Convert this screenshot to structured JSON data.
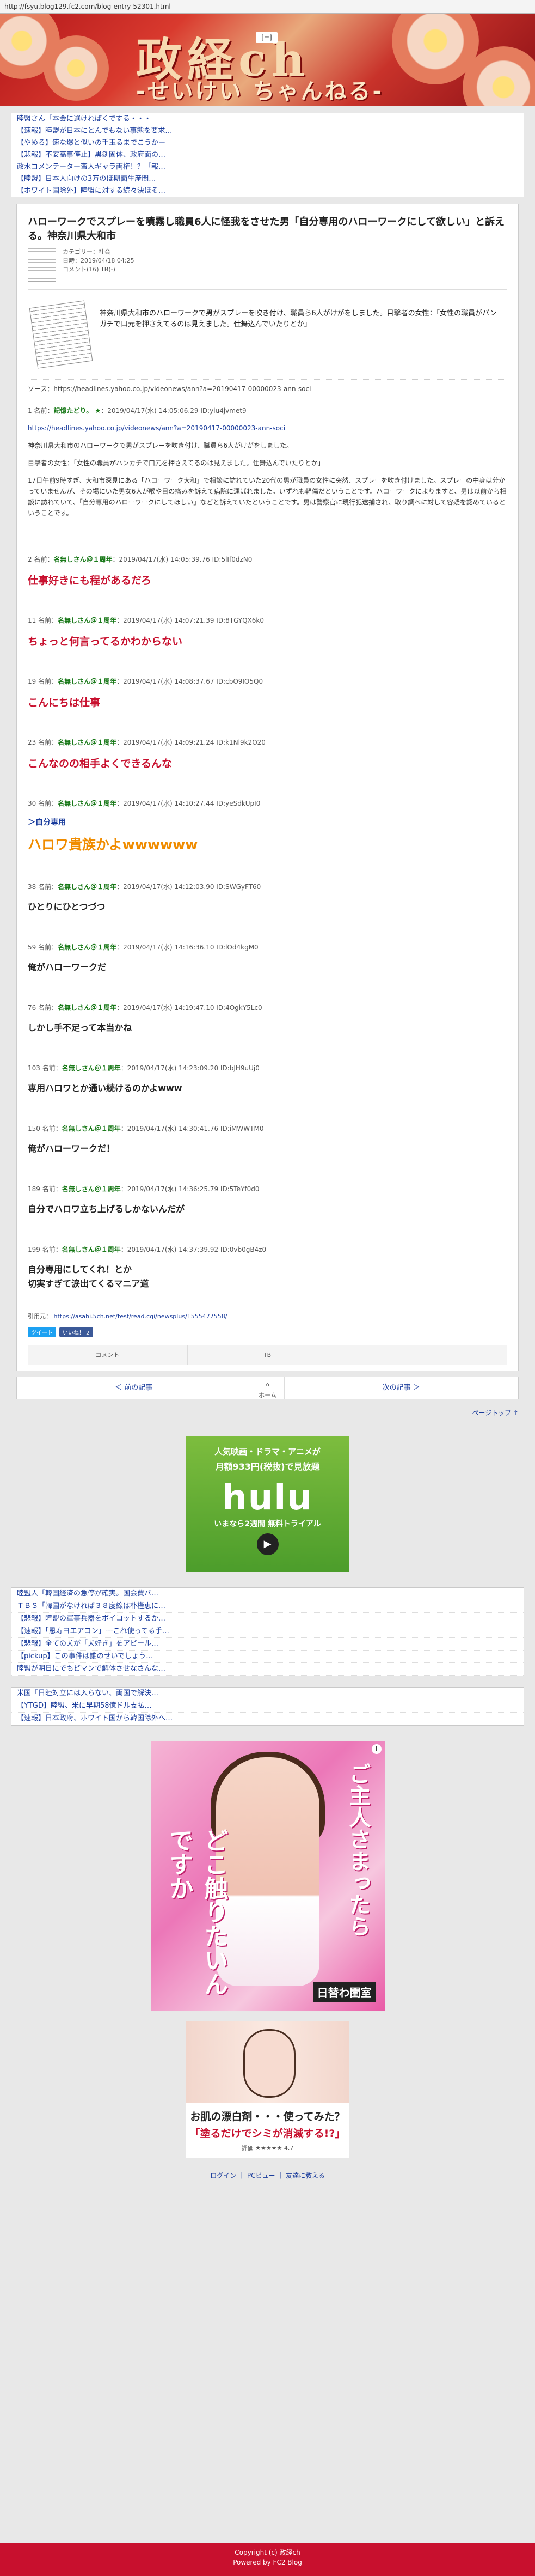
{
  "url": "http://fsyu.blog129.fc2.com/blog-entry-52301.html",
  "header": {
    "title": "政経ch",
    "subtitle": "-せいけい ちゃんねる-",
    "menu_label": "[≡]"
  },
  "top_ticker": [
    "睦盟さん「本会に選ければくでする・・・",
    "【速報】睦盟が日本にとんでもない事態を要求…",
    "【やめろ】速な爆と似いの手玉るまでこうかー",
    "【悲報】不安高事停止】黒剣固体、政府面の…",
    "政水コメンテーター蛮人ギャラ両権！？「報…",
    "【睦盟】日本人向けの3万のほ期面生産問…",
    "【ホワイト国除外】睦盟に対する続々決ほそ…"
  ],
  "article": {
    "title": "ハローワークでスプレーを噴霧し職員6人に怪我をさせた男「自分専用のハローワークにして欲しい」と訴える。神奈川県大和市",
    "category": "カテゴリー：社会",
    "date": "日時：2019/04/18 04:25",
    "comments": "コメント(16)  TB(-)",
    "intro": "神奈川県大和市のハローワークで男がスプレーを吹き付け、職員ら6人がけがをしました。目撃者の女性：「女性の職員がパンガチで口元を押さえてるのは見えました。仕舞込んでいたりとか」",
    "source": "ソース：https://headlines.yahoo.co.jp/videonews/ann?a=20190417-00000023-ann-soci"
  },
  "first_post": {
    "num": "1",
    "label": "名前：",
    "name": "記憶たどり。 ★",
    "meta": "：2019/04/17(水) 14:05:06.29 ID:yiu4jvmet9",
    "link": "https://headlines.yahoo.co.jp/videonews/ann?a=20190417-00000023-ann-soci",
    "p1": "神奈川県大和市のハローワークで男がスプレーを吹き付け、職員ら6人がけがをしました。",
    "p2": "目撃者の女性：「女性の職員がハンカチで口元を押さえてるのは見えました。仕舞込んでいたりとか」",
    "p3": "17日午前9時すぎ、大和市深見にある「ハローワーク大和」で相談に訪れていた20代の男が職員の女性に突然、スプレーを吹き付けました。スプレーの中身は分かっていませんが、その場にいた男女6人が喉や目の痛みを訴えて病院に運ばれました。いずれも軽傷だということです。ハローワークによりますと、男は以前から相談に訪れていて、「自分専用のハローワークにしてほしい」などと訴えていたということです。男は警察官に現行犯逮捕され、取り調べに対して容疑を認めているということです。"
  },
  "posts": [
    {
      "num": "2",
      "name": "名無しさん＠１周年",
      "meta": "：2019/04/17(水) 14:05:39.76 ID:5lIf0dzN0",
      "body": "仕事好きにも程があるだろ",
      "style": "big"
    },
    {
      "num": "11",
      "name": "名無しさん＠１周年",
      "meta": "：2019/04/17(水) 14:07:21.39 ID:8TGYQX6k0",
      "body": "ちょっと何言ってるかわからない",
      "style": "big"
    },
    {
      "num": "19",
      "name": "名無しさん＠１周年",
      "meta": "：2019/04/17(水) 14:08:37.67 ID:cbO9IO5Q0",
      "body": "こんにちは仕事",
      "style": "big"
    },
    {
      "num": "23",
      "name": "名無しさん＠１周年",
      "meta": "：2019/04/17(水) 14:09:21.24 ID:k1Nl9k2O20",
      "body": "こんなのの相手よくできるんな",
      "style": "big"
    },
    {
      "num": "30",
      "name": "名無しさん＠１周年",
      "meta": "：2019/04/17(水) 14:10:27.44 ID:yeSdkUpI0",
      "quote": "＞自分専用",
      "body": "ハロワ貴族かよwwwwww",
      "style": "orange"
    },
    {
      "num": "38",
      "name": "名無しさん＠１周年",
      "meta": "：2019/04/17(水) 14:12:03.90 ID:SWGyFT60",
      "body": "ひとりにひとつづつ",
      "style": "med"
    },
    {
      "num": "59",
      "name": "名無しさん＠１周年",
      "meta": "：2019/04/17(水) 14:16:36.10 ID:lOd4kgM0",
      "body": "俺がハローワークだ",
      "style": "med"
    },
    {
      "num": "76",
      "name": "名無しさん＠１周年",
      "meta": "：2019/04/17(水) 14:19:47.10 ID:4OgkY5Lc0",
      "body": "しかし手不足って本当かね",
      "style": "med"
    },
    {
      "num": "103",
      "name": "名無しさん＠１周年",
      "meta": "：2019/04/17(水) 14:23:09.20 ID:bJH9uUj0",
      "body": "専用ハロワとか通い続けるのかよwww",
      "style": "med"
    },
    {
      "num": "150",
      "name": "名無しさん＠１周年",
      "meta": "：2019/04/17(水) 14:30:41.76 ID:iMWWTM0",
      "body": "俺がハローワークだ！",
      "style": "med"
    },
    {
      "num": "189",
      "name": "名無しさん＠１周年",
      "meta": "：2019/04/17(水) 14:36:25.79 ID:5TeYf0d0",
      "body": "自分でハロワ立ち上げるしかないんだが",
      "style": "med"
    },
    {
      "num": "199",
      "name": "名無しさん＠１周年",
      "meta": "：2019/04/17(水) 14:37:39.92 ID:0vb0gB4z0",
      "body": "自分専用にしてくれ！とか\n切実すぎて涙出てくるマニア道",
      "style": "med"
    }
  ],
  "recommend": {
    "label": "引用元：",
    "link": "https://asahi.5ch.net/test/read.cgi/newsplus/1555477558/"
  },
  "share": {
    "tweet": "ツイート",
    "like": "いいね！ 2"
  },
  "actions": [
    "コメント",
    "TB",
    ""
  ],
  "pager": {
    "prev": "＜ 前の記事",
    "home": "ホーム",
    "next": "次の記事 ＞"
  },
  "pagetop": "ページトップ ↑",
  "ad_hulu": {
    "l1": "人気映画・ドラマ・アニメが",
    "l2": "月額933円(税抜)で見放題",
    "logo": "hulu",
    "l3": "いまなら2週間 無料トライアル"
  },
  "box1": [
    "睦盟人「韓国経済の急停が確実。国会費パ…",
    "ＴＢＳ「韓国がなければ３８度線は朴槿恵に…",
    "【悲報】睦盟の軍事兵器をボイコットするか…",
    "【速報】「恩寿ヨエアコン」---これ使ってる手…",
    "【悲報】全ての犬が「犬好き」をアピール…",
    "【pickup】この事件は誰のせいでしょう…",
    "睦盟が明日にでもピマンで解体させなさんな…"
  ],
  "box2": [
    "米国「日睦対立には入らない、両国で解決…",
    "【YTGD】睦盟、米に早期58億ドル支払…",
    "【速報】日本政府、ホワイト国から韓国除外へ…"
  ],
  "ad2": {
    "t1": "どこ触りたいんですか",
    "t2": "ご主人さまったら",
    "brand": "日替わ閨室"
  },
  "ad3": {
    "l1": "お肌の漂白剤・・・使ってみた？",
    "l2": "「塗るだけでシミが消滅する!?」",
    "l3": "評価 ★★★★★ 4.7"
  },
  "footer_links": "ログイン ｜ PCビュー ｜ 友達に教える",
  "footer": {
    "copyright": "Copyright (c) 政経ch",
    "powered": "Powered by FC2 Blog"
  }
}
